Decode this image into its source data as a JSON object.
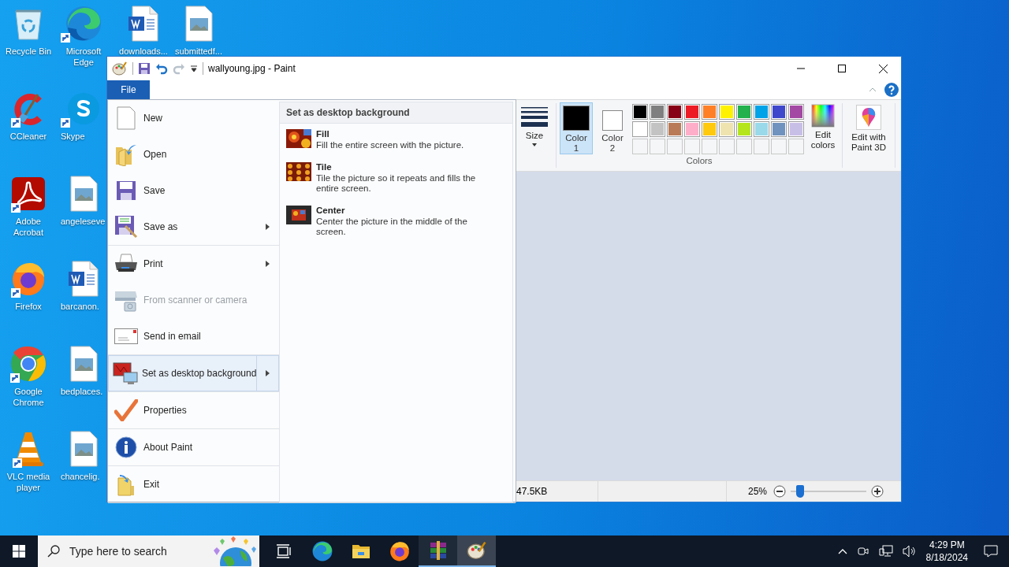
{
  "desktop": {
    "icons": [
      {
        "label": "Recycle Bin",
        "kind": "recycle",
        "shortcut": false
      },
      {
        "label": "CCleaner",
        "kind": "ccleaner",
        "shortcut": true
      },
      {
        "label": "Adobe Acrobat",
        "kind": "acrobat",
        "shortcut": true
      },
      {
        "label": "Firefox",
        "kind": "firefox",
        "shortcut": true
      },
      {
        "label": "Google Chrome",
        "kind": "chrome",
        "shortcut": true
      },
      {
        "label": "VLC media player",
        "kind": "vlc",
        "shortcut": true
      },
      {
        "label": "Microsoft Edge",
        "kind": "edge",
        "shortcut": true
      },
      {
        "label": "Skype",
        "kind": "skype",
        "shortcut": true
      },
      {
        "label": "angeleseve",
        "kind": "image",
        "shortcut": false
      },
      {
        "label": "barcanon.",
        "kind": "word",
        "shortcut": false
      },
      {
        "label": "bedplaces.",
        "kind": "image",
        "shortcut": false
      },
      {
        "label": "chancelig.",
        "kind": "image",
        "shortcut": false
      },
      {
        "label": "downloads...",
        "kind": "word",
        "shortcut": false
      },
      {
        "label": "submittedf...",
        "kind": "image",
        "shortcut": false
      }
    ]
  },
  "paint": {
    "title": "wallyoung.jpg - Paint",
    "ribbon_tabs": [
      {
        "label": "File",
        "selected": true
      }
    ],
    "size_tool": {
      "label": "Size"
    },
    "color_slots": [
      {
        "label": "Color 1",
        "color": "#000000",
        "selected": true
      },
      {
        "label": "Color 2",
        "color": "#ffffff",
        "selected": false
      }
    ],
    "palette": [
      {
        "kind": "swatch",
        "color": "#000000"
      },
      {
        "kind": "swatch",
        "color": "#7f7f7f"
      },
      {
        "kind": "swatch",
        "color": "#880015"
      },
      {
        "kind": "swatch",
        "color": "#ed1c24"
      },
      {
        "kind": "swatch",
        "color": "#ff7f27"
      },
      {
        "kind": "swatch",
        "color": "#fff200"
      },
      {
        "kind": "swatch",
        "color": "#22b14c"
      },
      {
        "kind": "swatch",
        "color": "#00a2e8"
      },
      {
        "kind": "swatch",
        "color": "#3f48cc"
      },
      {
        "kind": "swatch",
        "color": "#a349a4"
      },
      {
        "kind": "swatch",
        "color": "#ffffff"
      },
      {
        "kind": "swatch",
        "color": "#c3c3c3"
      },
      {
        "kind": "swatch",
        "color": "#b97a57"
      },
      {
        "kind": "swatch",
        "color": "#ffaec9"
      },
      {
        "kind": "swatch",
        "color": "#ffc90e"
      },
      {
        "kind": "swatch",
        "color": "#efe4b0"
      },
      {
        "kind": "swatch",
        "color": "#b5e61d"
      },
      {
        "kind": "swatch",
        "color": "#99d9ea"
      },
      {
        "kind": "swatch",
        "color": "#7092be"
      },
      {
        "kind": "swatch",
        "color": "#c8bfe7"
      },
      {
        "kind": "empty"
      },
      {
        "kind": "empty"
      },
      {
        "kind": "empty"
      },
      {
        "kind": "empty"
      },
      {
        "kind": "empty"
      },
      {
        "kind": "empty"
      },
      {
        "kind": "empty"
      },
      {
        "kind": "empty"
      },
      {
        "kind": "empty"
      },
      {
        "kind": "empty"
      }
    ],
    "edit_colors": "Edit colors",
    "colors_group": "Colors",
    "paint3d": "Edit with Paint 3D",
    "status": {
      "file_size": "47.5KB",
      "zoom": "25%"
    },
    "zoom_slider": {
      "level": 0.13
    }
  },
  "file_menu": {
    "groups": [
      {
        "items": [
          {
            "label": "New",
            "kind": "new",
            "has_submenu": false,
            "disabled": false,
            "selected": false
          },
          {
            "label": "Open",
            "kind": "open",
            "has_submenu": false,
            "disabled": false,
            "selected": false
          },
          {
            "label": "Save",
            "kind": "save",
            "has_submenu": false,
            "disabled": false,
            "selected": false
          },
          {
            "label": "Save as",
            "kind": "saveas",
            "has_submenu": true,
            "disabled": false,
            "selected": false
          }
        ]
      },
      {
        "items": [
          {
            "label": "Print",
            "kind": "print",
            "has_submenu": true,
            "disabled": false,
            "selected": false
          },
          {
            "label": "From scanner or camera",
            "kind": "scanner",
            "has_submenu": false,
            "disabled": true,
            "selected": false
          },
          {
            "label": "Send in email",
            "kind": "email",
            "has_submenu": false,
            "disabled": false,
            "selected": false
          }
        ]
      },
      {
        "items": [
          {
            "label": "Set as desktop background",
            "kind": "desktop",
            "has_submenu": true,
            "disabled": false,
            "selected": true
          }
        ]
      },
      {
        "items": [
          {
            "label": "Properties",
            "kind": "properties",
            "has_submenu": false,
            "disabled": false,
            "selected": false
          }
        ]
      },
      {
        "items": [
          {
            "label": "About Paint",
            "kind": "about",
            "has_submenu": false,
            "disabled": false,
            "selected": false
          }
        ]
      },
      {
        "items": [
          {
            "label": "Exit",
            "kind": "exit",
            "has_submenu": false,
            "disabled": false,
            "selected": false
          }
        ]
      }
    ],
    "submenu": {
      "title": "Set as desktop background",
      "options": [
        {
          "label": "Fill",
          "description": "Fill the entire screen with the picture.",
          "kind": "fill"
        },
        {
          "label": "Tile",
          "description": "Tile the picture so it repeats and fills the entire screen.",
          "kind": "tile"
        },
        {
          "label": "Center",
          "description": "Center the picture in the middle of the screen.",
          "kind": "center"
        }
      ]
    }
  },
  "taskbar": {
    "search_placeholder": "Type here to search",
    "apps": [
      {
        "kind": "edge",
        "running": false,
        "selected": false
      },
      {
        "kind": "explorer",
        "running": false,
        "selected": false
      },
      {
        "kind": "firefox",
        "running": false,
        "selected": false
      },
      {
        "kind": "winrar",
        "running": true,
        "selected": false
      },
      {
        "kind": "paint",
        "running": true,
        "selected": true
      }
    ],
    "time": "4:29 PM",
    "date": "8/18/2024"
  }
}
